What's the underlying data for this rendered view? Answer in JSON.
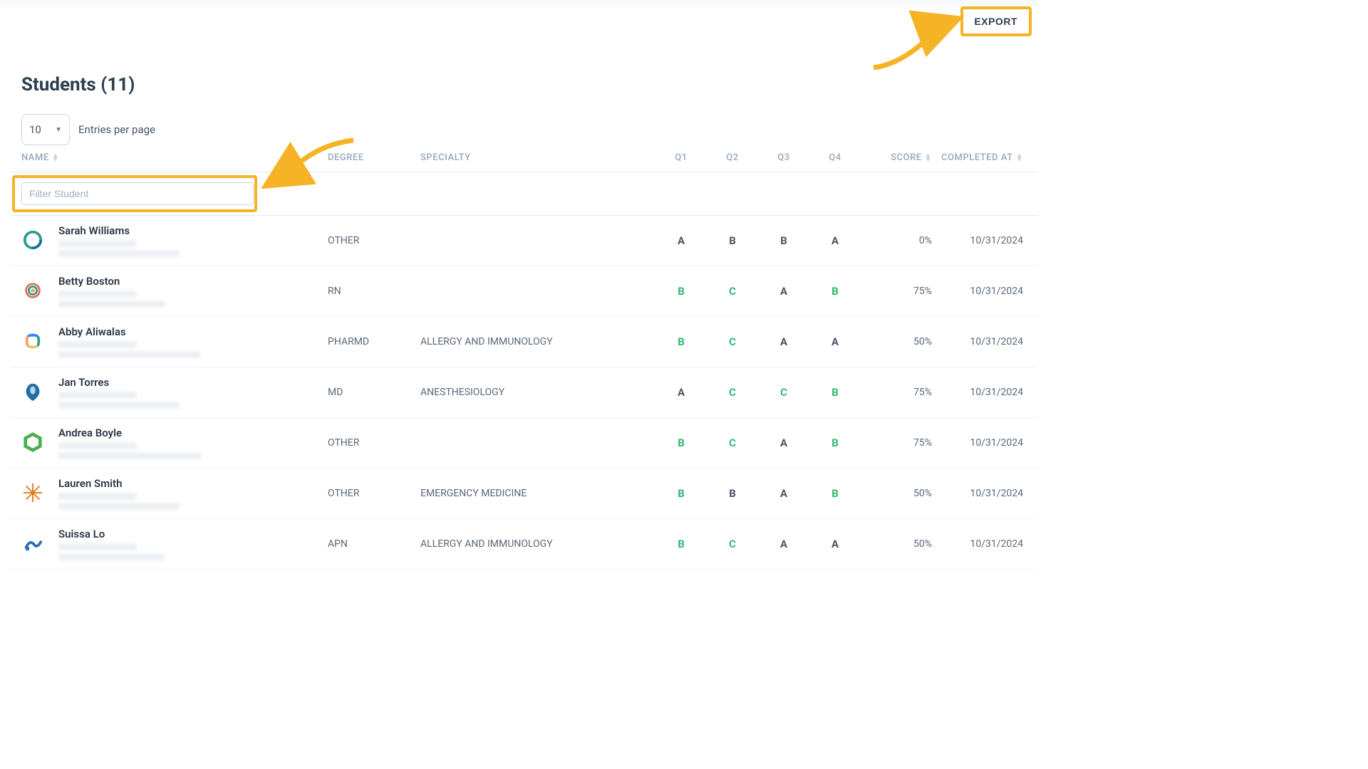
{
  "header": {
    "export_label": "EXPORT"
  },
  "title_prefix": "Students",
  "count": 11,
  "entries": {
    "value": "10",
    "label": "Entries per page"
  },
  "columns": {
    "name": "NAME",
    "degree": "DEGREE",
    "specialty": "SPECIALTY",
    "q1": "Q1",
    "q2": "Q2",
    "q3": "Q3",
    "q4": "Q4",
    "score": "SCORE",
    "completed": "COMPLETED AT"
  },
  "filter": {
    "placeholder": "Filter Student"
  },
  "rows": [
    {
      "name": "Sarah Williams",
      "degree": "OTHER",
      "specialty": "",
      "q1": "A",
      "q2": "B",
      "q3": "B",
      "q4": "A",
      "q1c": "dark",
      "q2c": "dark",
      "q3c": "dark",
      "q4c": "dark",
      "score": "0%",
      "completed": "10/31/2024",
      "bl2": "bl2"
    },
    {
      "name": "Betty Boston",
      "degree": "RN",
      "specialty": "",
      "q1": "B",
      "q2": "C",
      "q3": "A",
      "q4": "B",
      "q1c": "green",
      "q2c": "green",
      "q3c": "dark",
      "q4c": "green",
      "score": "75%",
      "completed": "10/31/2024",
      "bl2": "bl2b"
    },
    {
      "name": "Abby Aliwalas",
      "degree": "PHARMD",
      "specialty": "ALLERGY AND IMMUNOLOGY",
      "q1": "B",
      "q2": "C",
      "q3": "A",
      "q4": "A",
      "q1c": "green",
      "q2c": "green",
      "q3c": "dark",
      "q4c": "dark",
      "score": "50%",
      "completed": "10/31/2024",
      "bl2": "bl2c"
    },
    {
      "name": "Jan Torres",
      "degree": "MD",
      "specialty": "ANESTHESIOLOGY",
      "q1": "A",
      "q2": "C",
      "q3": "C",
      "q4": "B",
      "q1c": "dark",
      "q2c": "green",
      "q3c": "green",
      "q4c": "green",
      "score": "75%",
      "completed": "10/31/2024",
      "bl2": "bl2"
    },
    {
      "name": "Andrea Boyle",
      "degree": "OTHER",
      "specialty": "",
      "q1": "B",
      "q2": "C",
      "q3": "A",
      "q4": "B",
      "q1c": "green",
      "q2c": "green",
      "q3c": "dark",
      "q4c": "green",
      "score": "75%",
      "completed": "10/31/2024",
      "bl2": "bl2c"
    },
    {
      "name": "Lauren Smith",
      "degree": "OTHER",
      "specialty": "EMERGENCY MEDICINE",
      "q1": "B",
      "q2": "B",
      "q3": "A",
      "q4": "B",
      "q1c": "green",
      "q2c": "dark",
      "q3c": "dark",
      "q4c": "green",
      "score": "50%",
      "completed": "10/31/2024",
      "bl2": "bl2"
    },
    {
      "name": "Suissa Lo",
      "degree": "APN",
      "specialty": "ALLERGY AND IMMUNOLOGY",
      "q1": "B",
      "q2": "C",
      "q3": "A",
      "q4": "A",
      "q1c": "green",
      "q2c": "green",
      "q3c": "dark",
      "q4c": "dark",
      "score": "50%",
      "completed": "10/31/2024",
      "bl2": "bl2b"
    }
  ],
  "annotations": {
    "highlight_color": "#f5b325"
  }
}
